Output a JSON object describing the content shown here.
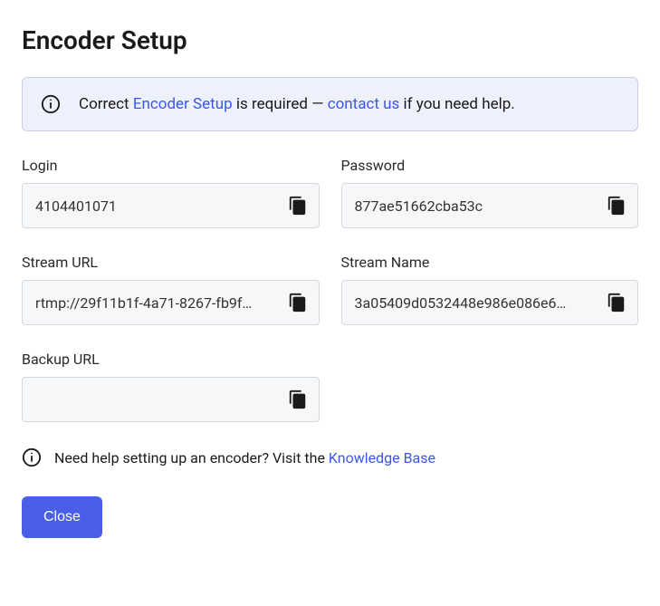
{
  "title": "Encoder Setup",
  "notice": {
    "prefix": "Correct ",
    "encoderLink": "Encoder Setup",
    "middle": " is required — ",
    "contactLink": "contact us",
    "suffix": " if you need help."
  },
  "fields": {
    "login": {
      "label": "Login",
      "value": "4104401071"
    },
    "password": {
      "label": "Password",
      "value": "877ae51662cba53c"
    },
    "streamUrl": {
      "label": "Stream URL",
      "value": "rtmp://29f11b1f-4a71-8267-fb9f…"
    },
    "streamName": {
      "label": "Stream Name",
      "value": "3a05409d0532448e986e086e6…"
    },
    "backupUrl": {
      "label": "Backup URL",
      "value": ""
    }
  },
  "help": {
    "text": "Need help setting up an encoder? Visit the ",
    "linkText": "Knowledge Base"
  },
  "closeButton": "Close"
}
